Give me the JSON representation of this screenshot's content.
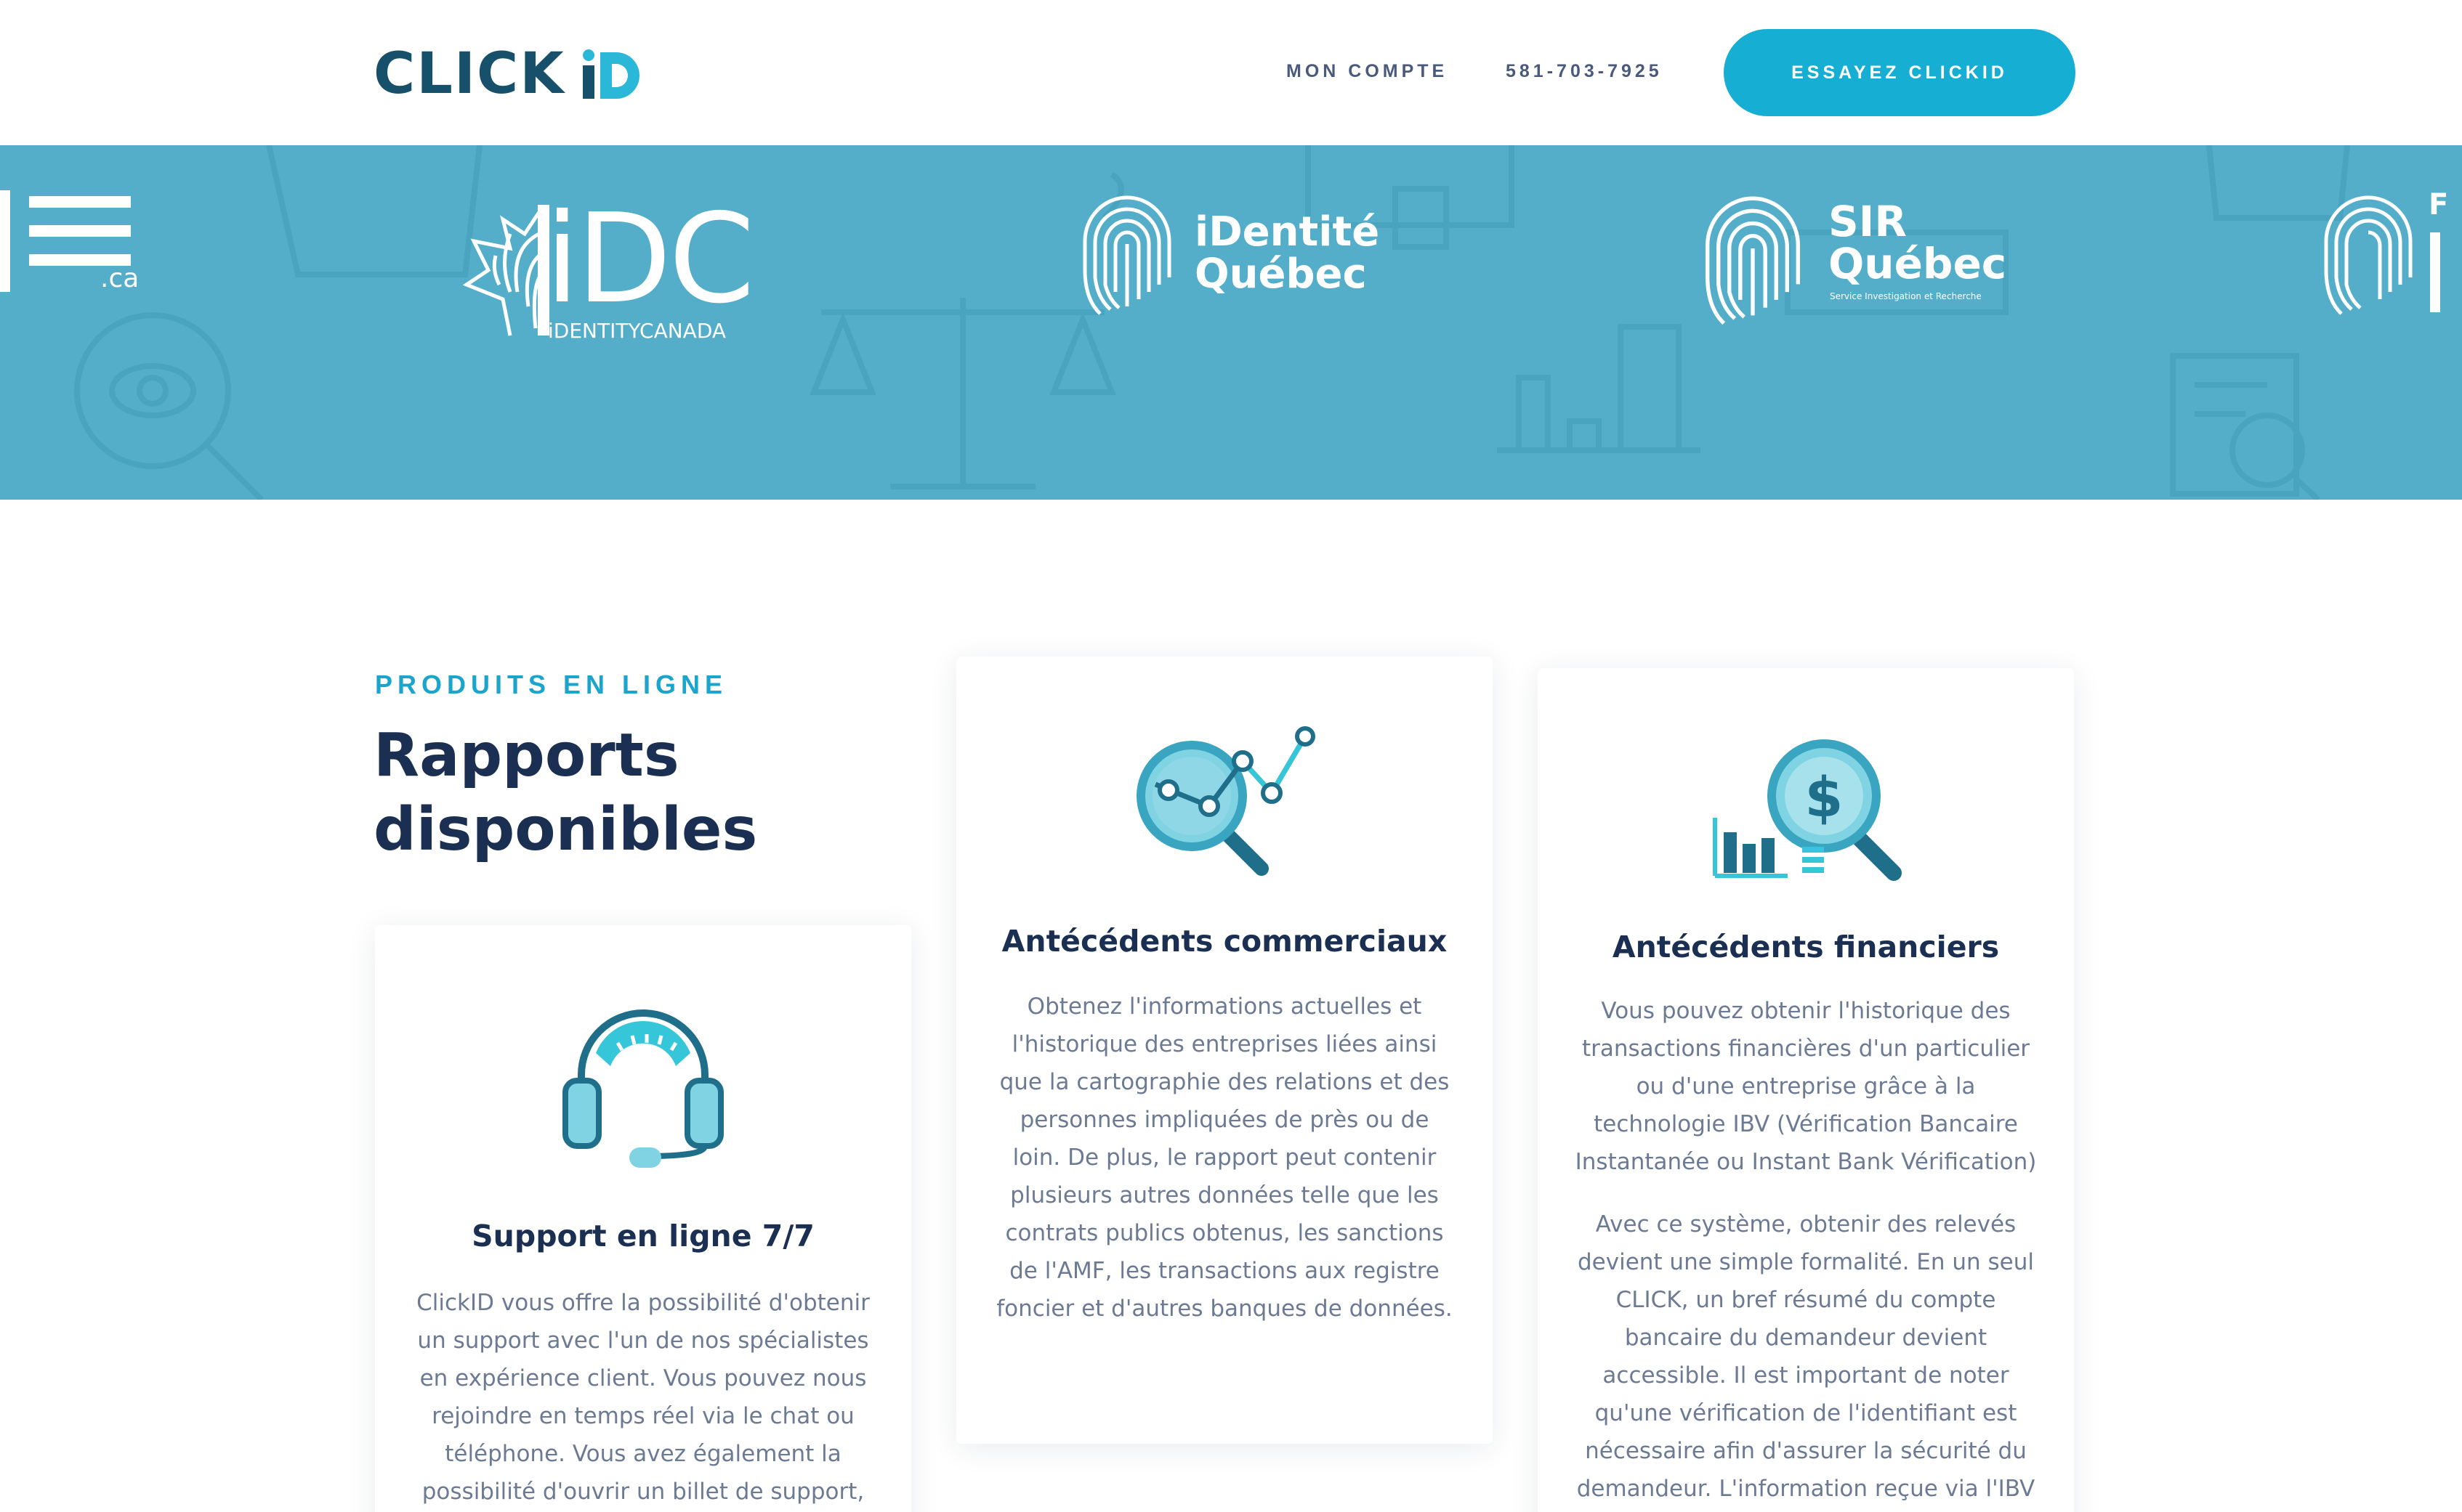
{
  "header": {
    "logo_text": "CLICK",
    "logo_suffix": "iD",
    "nav": {
      "account": "MON COMPTE",
      "phone": "581-703-7925"
    },
    "cta": "ESSAYEZ CLICKID"
  },
  "banner": {
    "partner_partial_left": ".ca",
    "partners": [
      {
        "name": "iDC",
        "sub": "iDENTITYCANADA"
      },
      {
        "line1": "iDentité",
        "line2": "Québec"
      },
      {
        "line1": "SIR",
        "line2": "Québec",
        "sub": "Service Investigation et Recherche"
      }
    ],
    "partner_partial_right": "F"
  },
  "section": {
    "eyebrow": "PRODUITS EN LIGNE",
    "title_line1": "Rapports",
    "title_line2": "disponibles"
  },
  "cards": {
    "support": {
      "title": "Support en ligne 7/7",
      "text": "ClickID vous offre la possibilité d'obtenir un support avec l'un de nos spécialistes en expérience client. Vous pouvez nous rejoindre en temps réel via le chat ou téléphone. Vous avez également la possibilité d'ouvrir un billet de support,"
    },
    "commercial": {
      "title": "Antécédents commerciaux",
      "text": "Obtenez l'informations actuelles et l'historique des entreprises liées ainsi que la cartographie des relations et des personnes impliquées de près ou de loin. De plus, le rapport peut contenir plusieurs autres données telle que les contrats publics obtenus, les sanctions de l'AMF, les transactions aux registre foncier et d'autres banques de données."
    },
    "financial": {
      "title": "Antécédents financiers",
      "text1": "Vous pouvez obtenir l'historique des transactions financières d'un particulier ou d'une entreprise grâce à la technologie IBV (Vérification Bancaire Instantanée ou Instant Bank Vérification)",
      "text2": "Avec ce système, obtenir des relevés devient une simple formalité. En un seul CLICK, un bref résumé du compte bancaire du demandeur devient accessible. Il est important de noter qu'une vérification de l'identifiant est nécessaire afin d'assurer la sécurité du demandeur. L'information reçue via l'IBV"
    }
  },
  "colors": {
    "brand_dark": "#16506b",
    "accent": "#16aed3",
    "banner": "#54aec9",
    "heading": "#1b2f52",
    "body_text": "#6c7a93"
  }
}
